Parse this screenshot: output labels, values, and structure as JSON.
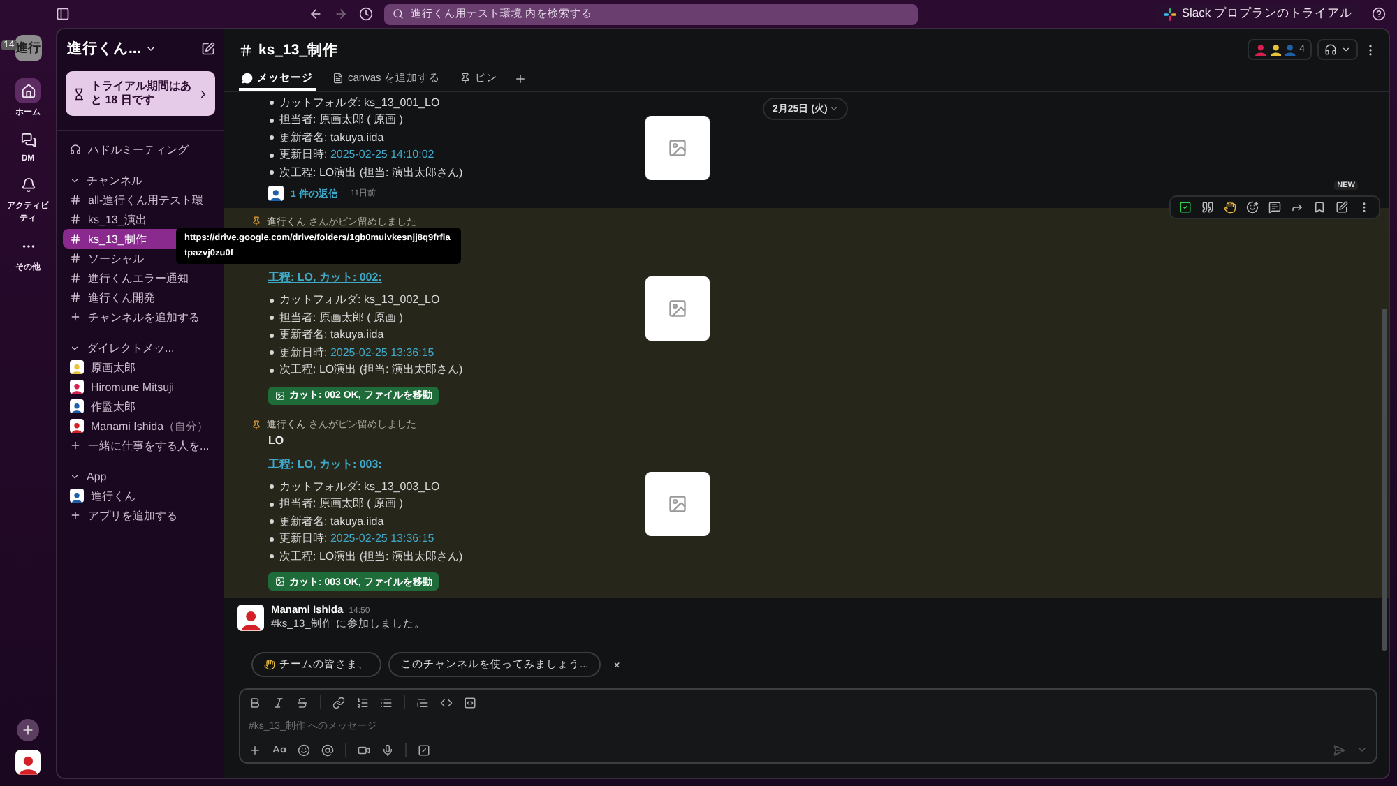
{
  "topbar": {
    "search_placeholder": "進行くん用テスト環境 内を検索する",
    "trial_button": "Slack プロプランのトライアル"
  },
  "rail": {
    "workspace": "進行",
    "badge": "14",
    "items": [
      {
        "label": "ホーム",
        "kind": "home",
        "selected": true
      },
      {
        "label": "DM",
        "kind": "dm",
        "selected": false
      },
      {
        "label": "アクティビティ",
        "kind": "activity",
        "selected": false
      },
      {
        "label": "その他",
        "kind": "more",
        "selected": false
      }
    ]
  },
  "sidebar": {
    "workspace_name": "進行くん...",
    "trial_banner": "トライアル期間はあと 18 日です",
    "huddle": "ハドルミーティング",
    "sections": [
      {
        "title": "チャンネル",
        "expanded": true,
        "items": [
          {
            "label": "all-進行くん用テスト環",
            "kind": "channel",
            "selected": false
          },
          {
            "label": "ks_13_演出",
            "kind": "channel",
            "selected": false
          },
          {
            "label": "ks_13_制作",
            "kind": "channel",
            "selected": true
          },
          {
            "label": "ソーシャル",
            "kind": "channel",
            "selected": false
          },
          {
            "label": "進行くんエラー通知",
            "kind": "channel",
            "selected": false
          },
          {
            "label": "進行くん開発",
            "kind": "channel",
            "selected": false
          }
        ],
        "add": "チャンネルを追加する"
      },
      {
        "title": "ダイレクトメッ...",
        "expanded": true,
        "items": [
          {
            "label": "原画太郎",
            "kind": "person",
            "color": "#e8c33a",
            "selected": false
          },
          {
            "label": "Hiromune Mitsuji",
            "kind": "person",
            "color": "#d6204f",
            "selected": false
          },
          {
            "label": "作監太郎",
            "kind": "person",
            "color": "#1f5fa8",
            "selected": false
          },
          {
            "label": "Manami Ishida",
            "suffix": "（自分）",
            "kind": "person",
            "color": "#d42027",
            "selected": false
          }
        ],
        "add": "一緒に仕事をする人を..."
      },
      {
        "title": "App",
        "expanded": true,
        "items": [
          {
            "label": "進行くん",
            "kind": "person",
            "color": "#1f5fa8",
            "selected": false
          }
        ],
        "add": "アプリを追加する"
      }
    ]
  },
  "channel": {
    "title": "ks_13_制作",
    "member_count": "4",
    "tabs": [
      {
        "label": "メッセージ",
        "kind": "messages",
        "selected": true
      },
      {
        "label": "canvas を追加する",
        "kind": "canvas",
        "selected": false
      },
      {
        "label": "ピン",
        "kind": "pins",
        "selected": false
      }
    ]
  },
  "date_divider": "2月25日 (火)",
  "messages": [
    {
      "kind": "bot_post",
      "pinned": false,
      "hovered": false,
      "bullets": [
        {
          "text": "カットフォルダ: ks_13_001_LO"
        },
        {
          "text": "担当者: 原画太郎 ( 原画 )"
        },
        {
          "text": "更新者名: takuya.iida"
        },
        {
          "text": "更新日時: ",
          "date": "2025-02-25 14:10:02"
        },
        {
          "text": "次工程: LO演出 (担当: 演出太郎さん)"
        }
      ],
      "thread": {
        "replies": "1 件の返信",
        "time": "11日前"
      }
    },
    {
      "kind": "bot_post",
      "pinned": true,
      "hovered": true,
      "pin_by": "進行くん",
      "pin_note": "さんがピン留めしました",
      "title": "工程: LO, カット: 002:",
      "title_hovered": true,
      "tooltip": "https://drive.google.com/drive/folders/1gb0muivkesnjj8q9frfiatpazvj0zu0f",
      "toolbar_badge": "NEW",
      "bullets": [
        {
          "text": "カットフォルダ: ks_13_002_LO"
        },
        {
          "text": "担当者: 原画太郎 ( 原画 )"
        },
        {
          "text": "更新者名: takuya.iida"
        },
        {
          "text": "更新日時: ",
          "date": "2025-02-25 13:36:15"
        },
        {
          "text": "次工程: LO演出 (担当: 演出太郎さん)"
        }
      ],
      "action": "カット: 002 OK, ファイルを移動"
    },
    {
      "kind": "bot_post",
      "pinned": true,
      "hovered": false,
      "pin_by": "進行くん",
      "pin_note": "さんがピン留めしました",
      "body": "LO",
      "title": "工程: LO, カット: 003:",
      "title_hovered": false,
      "bullets": [
        {
          "text": "カットフォルダ: ks_13_003_LO"
        },
        {
          "text": "担当者: 原画太郎 ( 原画 )"
        },
        {
          "text": "更新者名: takuya.iida"
        },
        {
          "text": "更新日時: ",
          "date": "2025-02-25 13:36:15"
        },
        {
          "text": "次工程: LO演出 (担当: 演出太郎さん)"
        }
      ],
      "action": "カット: 003 OK, ファイルを移動"
    },
    {
      "kind": "user",
      "pinned": false,
      "hovered": false,
      "author": "Manami Ishida",
      "time": "14:50",
      "text": "#ks_13_制作 に参加しました。"
    }
  ],
  "suggestions": [
    {
      "text": "チームの皆さま、",
      "kind": "wave"
    },
    {
      "text": "このチャンネルを使ってみましょう...",
      "kind": "plain"
    }
  ],
  "suggestion_close": "×",
  "composer": {
    "placeholder": "#ks_13_制作 へのメッセージ"
  }
}
